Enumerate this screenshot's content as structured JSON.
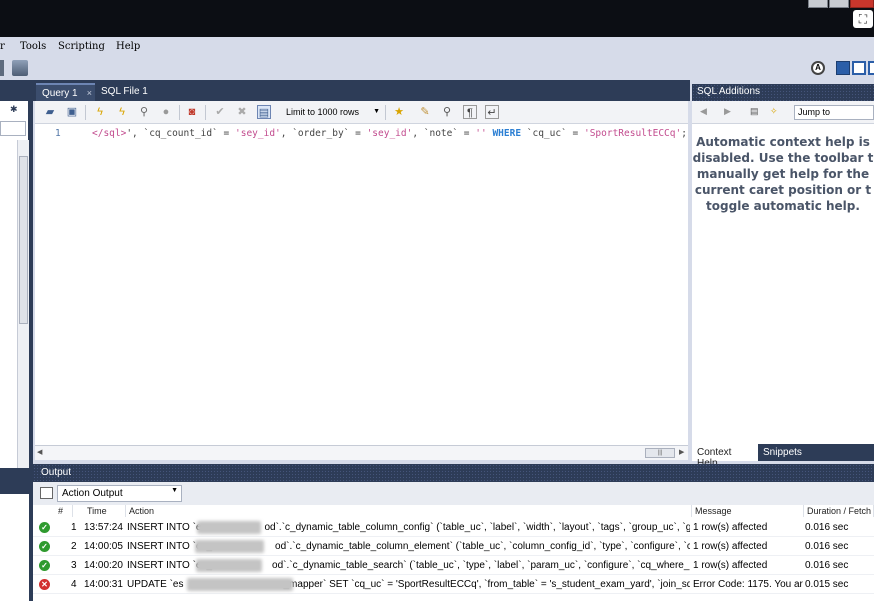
{
  "menu": [
    "r",
    "Tools",
    "Scripting",
    "Help"
  ],
  "editor_tabs": [
    {
      "label": "Query 1",
      "close": "×"
    },
    {
      "label": "SQL File 1"
    }
  ],
  "editor_toolbar": {
    "limit_label": "Limit to 1000 rows"
  },
  "editor": {
    "line_number": "1",
    "code_parts": [
      {
        "t": "</sql>",
        "c": "tag"
      },
      {
        "t": "', `cq_count_id` = ",
        "c": ""
      },
      {
        "t": "'sey_id'",
        "c": "str"
      },
      {
        "t": ", `order_by` = ",
        "c": ""
      },
      {
        "t": "'sey_id'",
        "c": "str"
      },
      {
        "t": ", `note` = ",
        "c": ""
      },
      {
        "t": "''",
        "c": "str"
      },
      {
        "t": " ",
        "c": ""
      },
      {
        "t": "WHERE",
        "c": "kw"
      },
      {
        "t": " `cq_uc` = ",
        "c": ""
      },
      {
        "t": "'SportResultECCq'",
        "c": "str"
      },
      {
        "t": ";",
        "c": ""
      }
    ]
  },
  "sql_additions": {
    "title": "SQL Additions",
    "jump_to": "Jump to",
    "help_text": "Automatic context help is\ndisabled. Use the toolbar t\nmanually get help for the\ncurrent caret position or t\ntoggle automatic help.",
    "tabs": [
      "Context Help",
      "Snippets"
    ]
  },
  "output": {
    "title": "Output",
    "mode": "Action Output",
    "columns": [
      "#",
      "Time",
      "Action",
      "Message",
      "Duration / Fetch"
    ],
    "rows": [
      {
        "status": "ok",
        "num": "1",
        "time": "13:57:24",
        "action_pre": "INSERT INTO `es",
        "action_post": "od`.`c_dynamic_table_column_config` (`table_uc`, `label`, `width`, `layout`, `tags`, `group_uc`, `group_sub`, `...",
        "message": "1 row(s) affected",
        "duration": "0.016 sec"
      },
      {
        "status": "ok",
        "num": "2",
        "time": "14:00:05",
        "action_pre": "INSERT INTO `es_",
        "action_post": "od`.`c_dynamic_table_column_element` (`table_uc`, `column_config_id`, `type`, `configure`, `cq_table_name`...",
        "message": "1 row(s) affected",
        "duration": "0.016 sec"
      },
      {
        "status": "ok",
        "num": "3",
        "time": "14:00:20",
        "action_pre": "INSERT INTO `es_",
        "action_post": "od`.`c_dynamic_table_search` (`table_uc`, `type`, `label`, `param_uc`, `configure`, `cq_where_id`, `state`, `ord...",
        "message": "1 row(s) affected",
        "duration": "0.016 sec"
      },
      {
        "status": "err",
        "num": "4",
        "time": "14:00:31",
        "action_pre": "UPDATE `es",
        "action_post": "_mapper` SET `cq_uc` = 'SportResultECCq', `from_table` = 's_student_exam_yard', `join_sql` = '<sql id=\\\"jo...",
        "message": "Error Code: 1175. You ar...",
        "duration": "0.015 sec"
      }
    ]
  },
  "colors": {
    "pane_header": "#2d3c57",
    "ok": "#2f9a2f",
    "error": "#d22f2f"
  }
}
